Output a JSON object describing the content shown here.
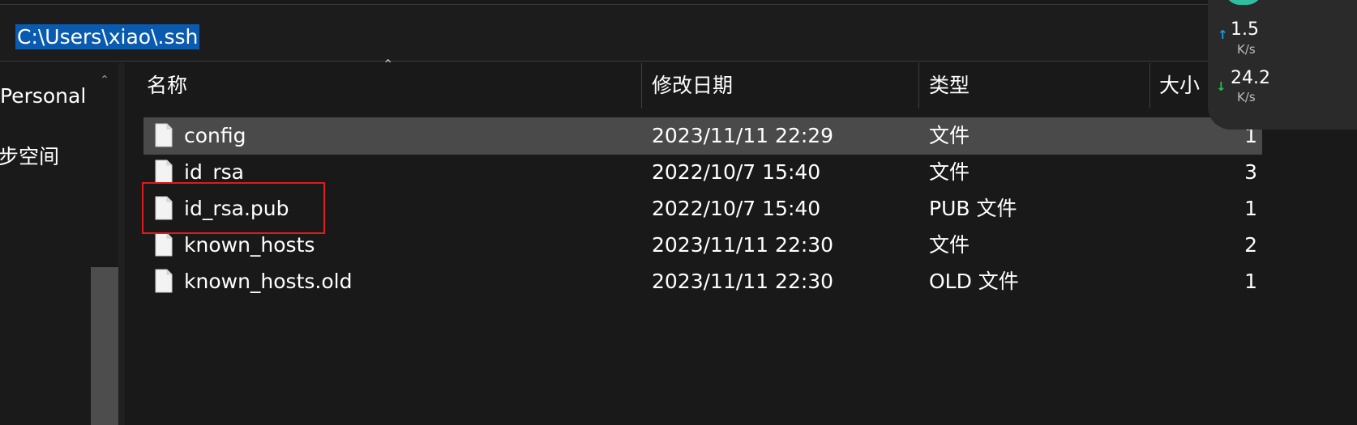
{
  "address": {
    "path": "C:\\Users\\xiao\\.ssh"
  },
  "nav": {
    "items": [
      {
        "label": "Personal"
      },
      {
        "label": "步空间"
      }
    ]
  },
  "columns": {
    "name": "名称",
    "modified": "修改日期",
    "type": "类型",
    "size": "大小"
  },
  "files": [
    {
      "name": "config",
      "modified": "2023/11/11 22:29",
      "type": "文件",
      "size": "1",
      "selected": true
    },
    {
      "name": "id_rsa",
      "modified": "2022/10/7 15:40",
      "type": "文件",
      "size": "3",
      "selected": false
    },
    {
      "name": "id_rsa.pub",
      "modified": "2022/10/7 15:40",
      "type": "PUB 文件",
      "size": "1",
      "selected": false,
      "highlighted": true
    },
    {
      "name": "known_hosts",
      "modified": "2023/11/11 22:30",
      "type": "文件",
      "size": "2",
      "selected": false
    },
    {
      "name": "known_hosts.old",
      "modified": "2023/11/11 22:30",
      "type": "OLD 文件",
      "size": "1",
      "selected": false
    }
  ],
  "network": {
    "upload": {
      "value": "1.5",
      "unit": "K/s",
      "color": "#1e9be0"
    },
    "download": {
      "value": "24.2",
      "unit": "K/s",
      "color": "#27c24c"
    }
  },
  "colors": {
    "background": "#191919",
    "selection": "#4a4a4a",
    "address_highlight": "#0a5bb0",
    "annotation_box": "#e01b1b"
  }
}
